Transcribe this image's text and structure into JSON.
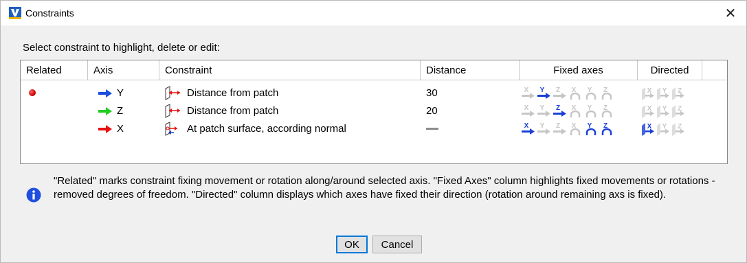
{
  "window": {
    "title": "Constraints",
    "app_icon": "vericut-logo-icon",
    "close_label": "✕"
  },
  "instruction": "Select constraint to highlight, delete or edit:",
  "table": {
    "columns": [
      "Related",
      "Axis",
      "Constraint",
      "Distance",
      "Fixed axes",
      "Directed"
    ],
    "rows": [
      {
        "related": true,
        "axis": "Y",
        "axis_color": "#1a4fe0",
        "constraint": "Distance from patch",
        "constraint_icon": "distance-from-patch-icon",
        "distance": "30",
        "fixed": [
          false,
          true,
          false,
          false,
          false,
          false
        ],
        "directed": [
          false,
          false,
          false
        ]
      },
      {
        "related": false,
        "axis": "Z",
        "axis_color": "#22cc22",
        "constraint": "Distance from patch",
        "constraint_icon": "distance-from-patch-icon",
        "distance": "20",
        "fixed": [
          false,
          false,
          true,
          false,
          false,
          false
        ],
        "directed": [
          false,
          false,
          false
        ]
      },
      {
        "related": false,
        "axis": "X",
        "axis_color": "#e81010",
        "constraint": "At patch surface, according normal",
        "constraint_icon": "patch-surface-normal-icon",
        "distance": "",
        "fixed": [
          true,
          false,
          false,
          false,
          true,
          true
        ],
        "directed": [
          true,
          false,
          false
        ]
      }
    ]
  },
  "fixed_axis_letters": [
    "X",
    "Y",
    "Z",
    "X",
    "Y",
    "Z"
  ],
  "directed_axis_letters": [
    "X",
    "Y",
    "Z"
  ],
  "info": {
    "icon": "info-icon",
    "text": "\"Related\" marks constraint fixing movement or rotation along/around selected axis.  \"Fixed Axes\" column highlights fixed movements or rotations - removed degrees of freedom. \"Directed\" column displays which axes have fixed their direction (rotation around remaining axs is fixed)."
  },
  "buttons": {
    "ok": "OK",
    "cancel": "Cancel"
  },
  "colors": {
    "active": "#1a3fd6",
    "inactive": "#c6c6c6",
    "related": "#d00000"
  }
}
